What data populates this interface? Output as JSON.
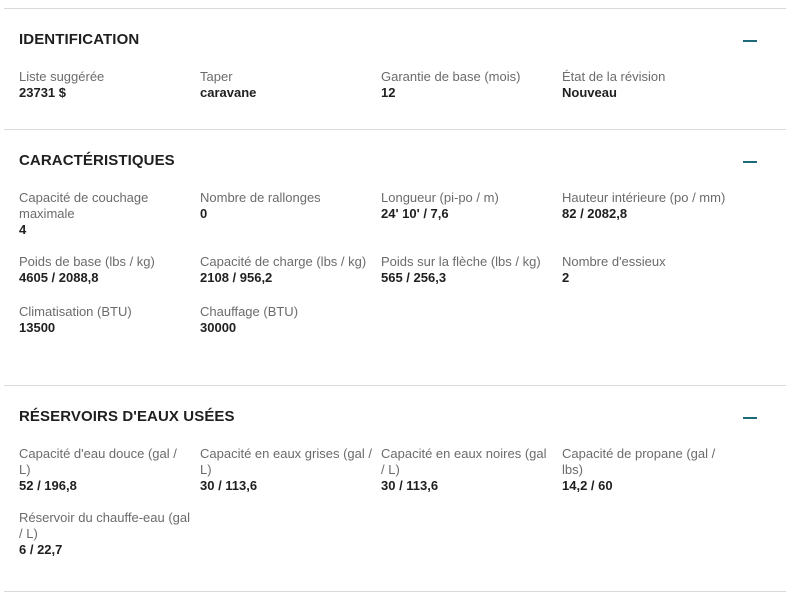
{
  "sections": [
    {
      "title": "IDENTIFICATION",
      "items": [
        {
          "label": "Liste suggérée",
          "value": "23731 $"
        },
        {
          "label": "Taper",
          "value": "caravane"
        },
        {
          "label": "Garantie de base (mois)",
          "value": "12"
        },
        {
          "label": "État de la révision",
          "value": "Nouveau"
        }
      ]
    },
    {
      "title": "CARACTÉRISTIQUES",
      "items": [
        {
          "label": "Capacité de couchage maximale",
          "value": "4"
        },
        {
          "label": "Nombre de rallonges",
          "value": "0"
        },
        {
          "label": "Longueur (pi-po / m)",
          "value": "24' 10' / 7,6"
        },
        {
          "label": "Hauteur intérieure (po / mm)",
          "value": "82 / 2082,8"
        },
        {
          "label": "Poids de base (lbs / kg)",
          "value": "4605 / 2088,8"
        },
        {
          "label": "Capacité de charge (lbs / kg)",
          "value": "2108 / 956,2"
        },
        {
          "label": "Poids sur la flèche (lbs / kg)",
          "value": "565 / 256,3"
        },
        {
          "label": "Nombre d'essieux",
          "value": "2"
        },
        {
          "label": "Climatisation (BTU)",
          "value": "13500"
        },
        {
          "label": "Chauffage (BTU)",
          "value": "30000"
        }
      ]
    },
    {
      "title": "RÉSERVOIRS D'EAUX USÉES",
      "items": [
        {
          "label": "Capacité d'eau douce (gal / L)",
          "value": "52 / 196,8"
        },
        {
          "label": "Capacité en eaux grises (gal / L)",
          "value": "30 / 113,6"
        },
        {
          "label": "Capacité en eaux noires (gal / L)",
          "value": "30 / 113,6"
        },
        {
          "label": "Capacité de propane (gal / lbs)",
          "value": "14,2 / 60"
        },
        {
          "label": "Réservoir du chauffe-eau (gal / L)",
          "value": "6 / 22,7"
        }
      ]
    }
  ]
}
